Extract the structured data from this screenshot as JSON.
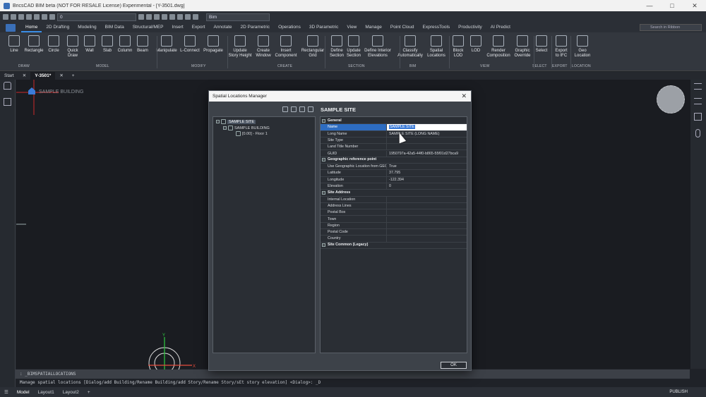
{
  "window": {
    "title": "BricsCAD BIM beta (NOT FOR RESALE License) Experimental - [Y-3501.dwg]"
  },
  "qat": {
    "layer": "0",
    "workspace": "Bim"
  },
  "tabs": [
    "Home",
    "2D Drafting",
    "Modeling",
    "BIM Data",
    "Structural/MEP",
    "Insert",
    "Export",
    "Annotate",
    "2D Parametric",
    "Operations",
    "3D Parametric",
    "View",
    "Manage",
    "Point Cloud",
    "ExpressTools",
    "Productivity",
    "AI Predict"
  ],
  "search_placeholder": "Search in Ribbon",
  "ribbon": {
    "buttons": [
      "Line",
      "Rectangle",
      "Circle",
      "Quick\nDraw",
      "Wall",
      "Slab",
      "Column",
      "Beam",
      "Manipulate",
      "L-Connect",
      "Propagate",
      "Update\nStory Height",
      "Create\nWindow",
      "Insert\nComponent",
      "Rectangular\nGrid",
      "Define\nSection",
      "Update\nSection",
      "Define Interior\nElevations",
      "Classify\nAutomatically",
      "Spatial\nLocations",
      "Block\nLOD",
      "LOD",
      "Render\nComposition",
      "Graphic\nOverride",
      "Select",
      "Export\nto IFC",
      "Geo\nLocation"
    ],
    "groups": [
      "DRAW",
      "MODEL",
      "MODIFY",
      "CREATE",
      "SECTION",
      "BIM",
      "VIEW",
      "SELECT",
      "EXPORT",
      "LOCATION"
    ]
  },
  "file_tabs": [
    "Start",
    "Y-3501*"
  ],
  "canvas": {
    "building_label": "SAMPLE BUILDING"
  },
  "dialog": {
    "title": "Spatial Locations Manager",
    "panel_title": "SAMPLE SITE",
    "tree": {
      "site": "SAMPLE SITE",
      "building": "SAMPLE BUILDING",
      "floor": "[0.00] - Floor 1"
    },
    "sections": {
      "general": {
        "label": "General",
        "rows": [
          {
            "k": "Name",
            "v": "SAMPLE SITE"
          },
          {
            "k": "Long Name",
            "v": "SAMPLE SITE (LONG NAME)"
          },
          {
            "k": "Site Type",
            "v": ""
          },
          {
            "k": "Land Title Number",
            "v": ""
          },
          {
            "k": "GUID",
            "v": "1950797a-42a5-44f0-b865-55f01d27bca9"
          }
        ]
      },
      "geo": {
        "label": "Geographic reference point",
        "rows": [
          {
            "k": "Use Geographic Location from GEO",
            "v": "True"
          },
          {
            "k": "Latitude",
            "v": "37.795"
          },
          {
            "k": "Longitude",
            "v": "-122.394"
          },
          {
            "k": "Elevation",
            "v": "0"
          }
        ]
      },
      "address": {
        "label": "Site Address",
        "rows": [
          {
            "k": "Internal Location",
            "v": ""
          },
          {
            "k": "Address Lines",
            "v": ""
          },
          {
            "k": "Postal Box",
            "v": ""
          },
          {
            "k": "Town",
            "v": ""
          },
          {
            "k": "Region",
            "v": ""
          },
          {
            "k": "Postal Code",
            "v": ""
          },
          {
            "k": "Country",
            "v": ""
          }
        ]
      },
      "legacy": {
        "label": "Site Common (Legacy)"
      }
    },
    "ok": "OK"
  },
  "command": {
    "current": ": _BIMSPATIALLOCATIONS",
    "prompt": "Manage spatial locations [Dialog/add Building/Rename Building/add Story/Rename Story/sEt story elevation] <Dialog>: _D"
  },
  "status": {
    "layouts": [
      "Model",
      "Layout1",
      "Layout2"
    ],
    "publish": "PUBLISH"
  }
}
